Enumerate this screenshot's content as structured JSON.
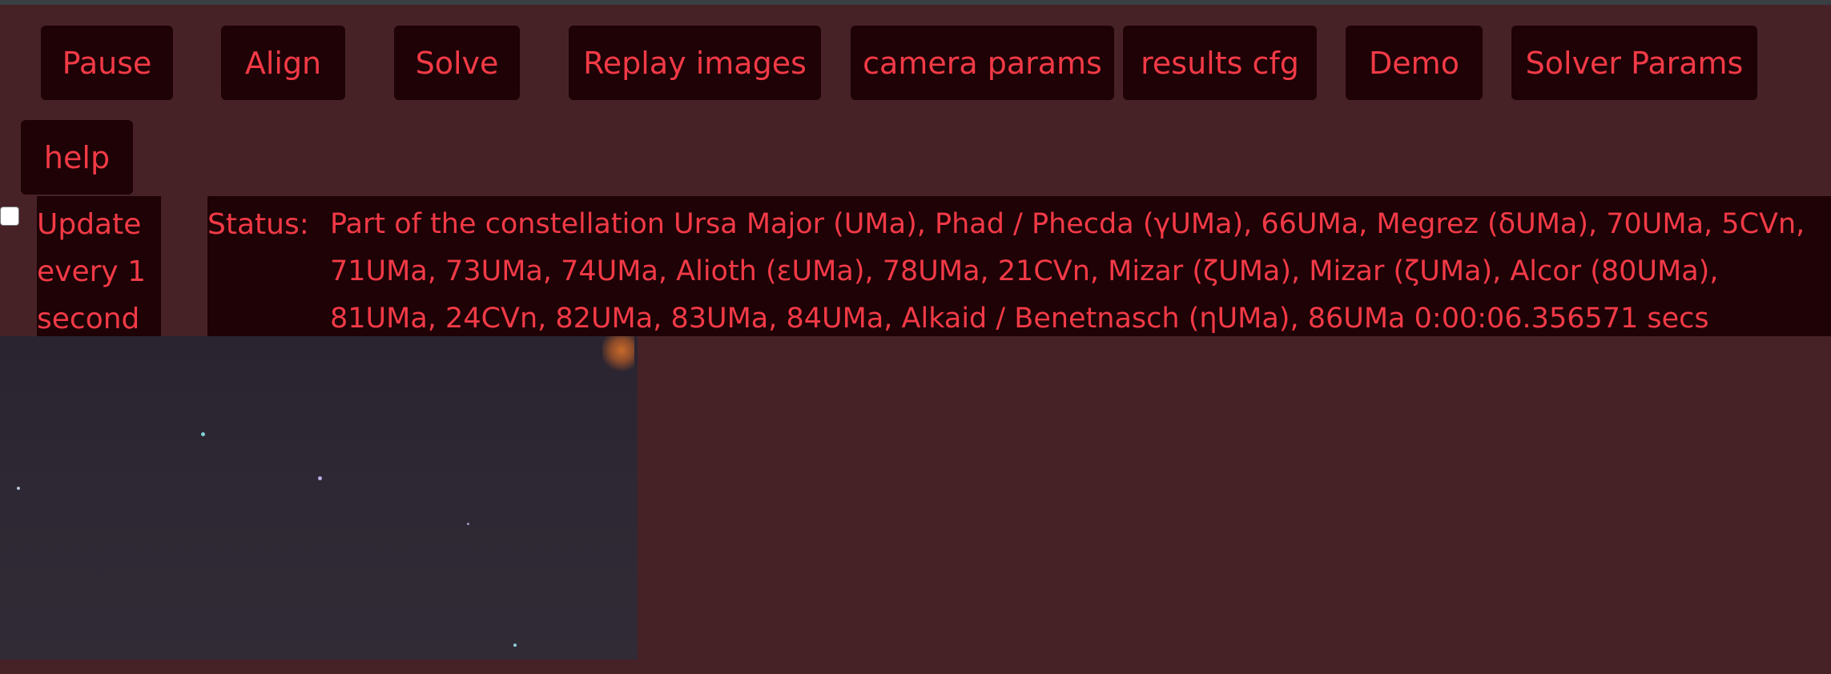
{
  "toolbar": {
    "buttons": [
      {
        "label": "Pause"
      },
      {
        "label": "Align"
      },
      {
        "label": "Solve"
      },
      {
        "label": "Replay images"
      },
      {
        "label": "camera params"
      },
      {
        "label": "results cfg"
      },
      {
        "label": "Demo"
      },
      {
        "label": "Solver Params"
      },
      {
        "label": "help"
      }
    ]
  },
  "update": {
    "checked": false,
    "label": "Update every 1 second"
  },
  "status": {
    "label": "Status:",
    "text": "Part of the constellation Ursa Major (UMa), Phad / Phecda (γUMa), 66UMa, Megrez (δUMa), 70UMa, 5CVn, 71UMa, 73UMa, 74UMa, Alioth (εUMa), 78UMa, 21CVn, Mizar (ζUMa), Mizar (ζUMa), Alcor (80UMa), 81UMa, 24CVn, 82UMa, 83UMa, 84UMa, Alkaid / Benetnasch (ηUMa), 86UMa 0:00:06.356571 secs"
  },
  "colors": {
    "background": "#462227",
    "button_bg": "#1e0206",
    "text": "#f23a46"
  }
}
